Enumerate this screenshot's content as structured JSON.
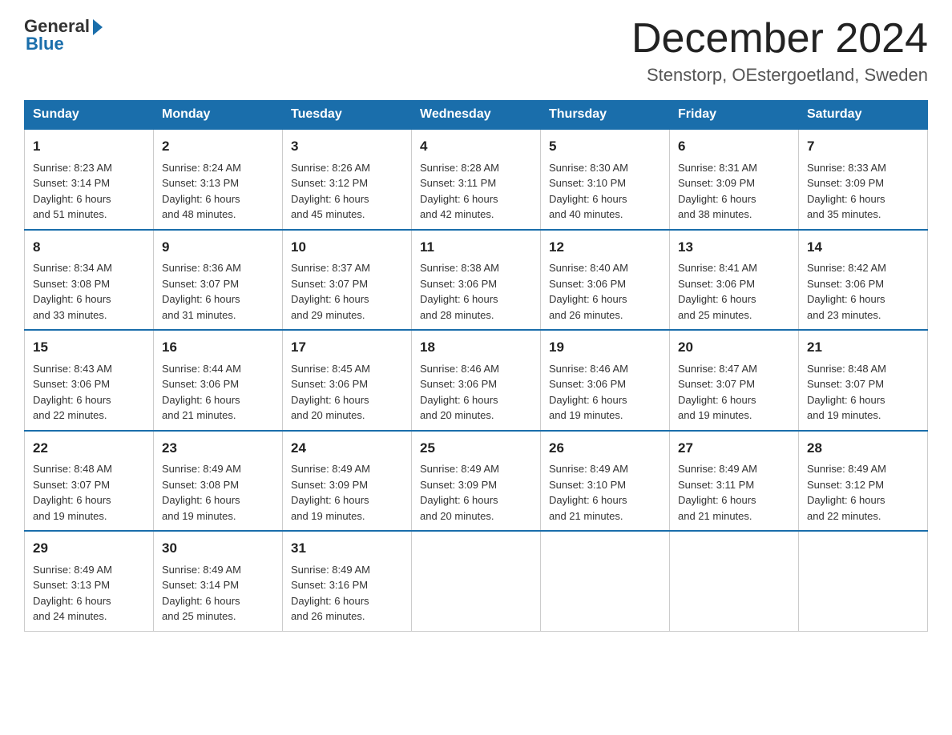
{
  "logo": {
    "general": "General",
    "blue": "Blue"
  },
  "title": "December 2024",
  "location": "Stenstorp, OEstergoetland, Sweden",
  "headers": [
    "Sunday",
    "Monday",
    "Tuesday",
    "Wednesday",
    "Thursday",
    "Friday",
    "Saturday"
  ],
  "weeks": [
    [
      {
        "day": "1",
        "sunrise": "Sunrise: 8:23 AM",
        "sunset": "Sunset: 3:14 PM",
        "daylight": "Daylight: 6 hours",
        "minutes": "and 51 minutes."
      },
      {
        "day": "2",
        "sunrise": "Sunrise: 8:24 AM",
        "sunset": "Sunset: 3:13 PM",
        "daylight": "Daylight: 6 hours",
        "minutes": "and 48 minutes."
      },
      {
        "day": "3",
        "sunrise": "Sunrise: 8:26 AM",
        "sunset": "Sunset: 3:12 PM",
        "daylight": "Daylight: 6 hours",
        "minutes": "and 45 minutes."
      },
      {
        "day": "4",
        "sunrise": "Sunrise: 8:28 AM",
        "sunset": "Sunset: 3:11 PM",
        "daylight": "Daylight: 6 hours",
        "minutes": "and 42 minutes."
      },
      {
        "day": "5",
        "sunrise": "Sunrise: 8:30 AM",
        "sunset": "Sunset: 3:10 PM",
        "daylight": "Daylight: 6 hours",
        "minutes": "and 40 minutes."
      },
      {
        "day": "6",
        "sunrise": "Sunrise: 8:31 AM",
        "sunset": "Sunset: 3:09 PM",
        "daylight": "Daylight: 6 hours",
        "minutes": "and 38 minutes."
      },
      {
        "day": "7",
        "sunrise": "Sunrise: 8:33 AM",
        "sunset": "Sunset: 3:09 PM",
        "daylight": "Daylight: 6 hours",
        "minutes": "and 35 minutes."
      }
    ],
    [
      {
        "day": "8",
        "sunrise": "Sunrise: 8:34 AM",
        "sunset": "Sunset: 3:08 PM",
        "daylight": "Daylight: 6 hours",
        "minutes": "and 33 minutes."
      },
      {
        "day": "9",
        "sunrise": "Sunrise: 8:36 AM",
        "sunset": "Sunset: 3:07 PM",
        "daylight": "Daylight: 6 hours",
        "minutes": "and 31 minutes."
      },
      {
        "day": "10",
        "sunrise": "Sunrise: 8:37 AM",
        "sunset": "Sunset: 3:07 PM",
        "daylight": "Daylight: 6 hours",
        "minutes": "and 29 minutes."
      },
      {
        "day": "11",
        "sunrise": "Sunrise: 8:38 AM",
        "sunset": "Sunset: 3:06 PM",
        "daylight": "Daylight: 6 hours",
        "minutes": "and 28 minutes."
      },
      {
        "day": "12",
        "sunrise": "Sunrise: 8:40 AM",
        "sunset": "Sunset: 3:06 PM",
        "daylight": "Daylight: 6 hours",
        "minutes": "and 26 minutes."
      },
      {
        "day": "13",
        "sunrise": "Sunrise: 8:41 AM",
        "sunset": "Sunset: 3:06 PM",
        "daylight": "Daylight: 6 hours",
        "minutes": "and 25 minutes."
      },
      {
        "day": "14",
        "sunrise": "Sunrise: 8:42 AM",
        "sunset": "Sunset: 3:06 PM",
        "daylight": "Daylight: 6 hours",
        "minutes": "and 23 minutes."
      }
    ],
    [
      {
        "day": "15",
        "sunrise": "Sunrise: 8:43 AM",
        "sunset": "Sunset: 3:06 PM",
        "daylight": "Daylight: 6 hours",
        "minutes": "and 22 minutes."
      },
      {
        "day": "16",
        "sunrise": "Sunrise: 8:44 AM",
        "sunset": "Sunset: 3:06 PM",
        "daylight": "Daylight: 6 hours",
        "minutes": "and 21 minutes."
      },
      {
        "day": "17",
        "sunrise": "Sunrise: 8:45 AM",
        "sunset": "Sunset: 3:06 PM",
        "daylight": "Daylight: 6 hours",
        "minutes": "and 20 minutes."
      },
      {
        "day": "18",
        "sunrise": "Sunrise: 8:46 AM",
        "sunset": "Sunset: 3:06 PM",
        "daylight": "Daylight: 6 hours",
        "minutes": "and 20 minutes."
      },
      {
        "day": "19",
        "sunrise": "Sunrise: 8:46 AM",
        "sunset": "Sunset: 3:06 PM",
        "daylight": "Daylight: 6 hours",
        "minutes": "and 19 minutes."
      },
      {
        "day": "20",
        "sunrise": "Sunrise: 8:47 AM",
        "sunset": "Sunset: 3:07 PM",
        "daylight": "Daylight: 6 hours",
        "minutes": "and 19 minutes."
      },
      {
        "day": "21",
        "sunrise": "Sunrise: 8:48 AM",
        "sunset": "Sunset: 3:07 PM",
        "daylight": "Daylight: 6 hours",
        "minutes": "and 19 minutes."
      }
    ],
    [
      {
        "day": "22",
        "sunrise": "Sunrise: 8:48 AM",
        "sunset": "Sunset: 3:07 PM",
        "daylight": "Daylight: 6 hours",
        "minutes": "and 19 minutes."
      },
      {
        "day": "23",
        "sunrise": "Sunrise: 8:49 AM",
        "sunset": "Sunset: 3:08 PM",
        "daylight": "Daylight: 6 hours",
        "minutes": "and 19 minutes."
      },
      {
        "day": "24",
        "sunrise": "Sunrise: 8:49 AM",
        "sunset": "Sunset: 3:09 PM",
        "daylight": "Daylight: 6 hours",
        "minutes": "and 19 minutes."
      },
      {
        "day": "25",
        "sunrise": "Sunrise: 8:49 AM",
        "sunset": "Sunset: 3:09 PM",
        "daylight": "Daylight: 6 hours",
        "minutes": "and 20 minutes."
      },
      {
        "day": "26",
        "sunrise": "Sunrise: 8:49 AM",
        "sunset": "Sunset: 3:10 PM",
        "daylight": "Daylight: 6 hours",
        "minutes": "and 21 minutes."
      },
      {
        "day": "27",
        "sunrise": "Sunrise: 8:49 AM",
        "sunset": "Sunset: 3:11 PM",
        "daylight": "Daylight: 6 hours",
        "minutes": "and 21 minutes."
      },
      {
        "day": "28",
        "sunrise": "Sunrise: 8:49 AM",
        "sunset": "Sunset: 3:12 PM",
        "daylight": "Daylight: 6 hours",
        "minutes": "and 22 minutes."
      }
    ],
    [
      {
        "day": "29",
        "sunrise": "Sunrise: 8:49 AM",
        "sunset": "Sunset: 3:13 PM",
        "daylight": "Daylight: 6 hours",
        "minutes": "and 24 minutes."
      },
      {
        "day": "30",
        "sunrise": "Sunrise: 8:49 AM",
        "sunset": "Sunset: 3:14 PM",
        "daylight": "Daylight: 6 hours",
        "minutes": "and 25 minutes."
      },
      {
        "day": "31",
        "sunrise": "Sunrise: 8:49 AM",
        "sunset": "Sunset: 3:16 PM",
        "daylight": "Daylight: 6 hours",
        "minutes": "and 26 minutes."
      },
      null,
      null,
      null,
      null
    ]
  ]
}
